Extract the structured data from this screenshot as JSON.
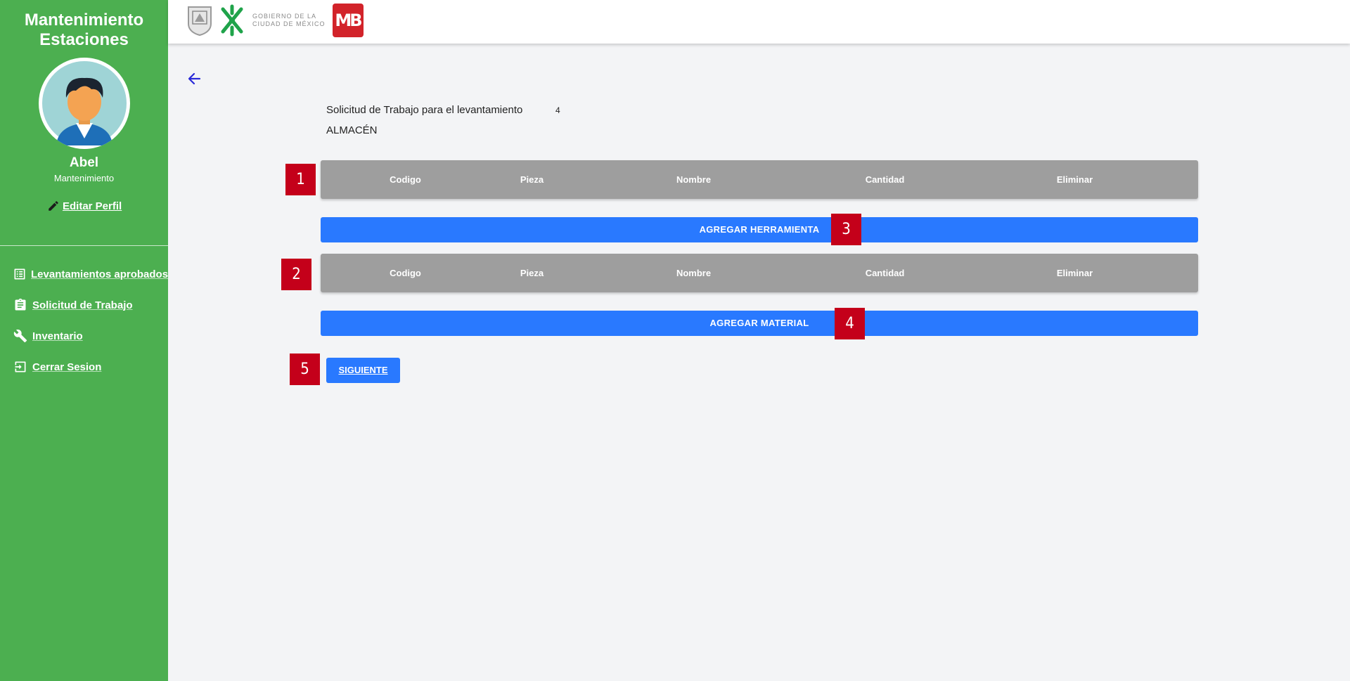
{
  "sidebar": {
    "app_title_line1": "Mantenimiento",
    "app_title_line2": "Estaciones",
    "user_name": "Abel",
    "user_role": "Mantenimiento",
    "edit_profile": "Editar Perfil",
    "items": [
      {
        "label": "Levantamientos aprobados",
        "icon": "list-icon"
      },
      {
        "label": "Solicitud de Trabajo",
        "icon": "clipboard-icon"
      },
      {
        "label": "Inventario",
        "icon": "wrench-icon"
      },
      {
        "label": "Cerrar Sesion",
        "icon": "logout-icon"
      }
    ],
    "color": "#4caf50"
  },
  "header": {
    "logo_gov_line1": "GOBIERNO DE LA",
    "logo_gov_line2": "CIUDAD DE MÉXICO",
    "logo_mb": "MB"
  },
  "main": {
    "request_title": "Solicitud de Trabajo para el levantamiento",
    "request_number": "4",
    "warehouse": "ALMACÉN",
    "tools_table": {
      "columns": [
        "Codigo",
        "Pieza",
        "Nombre",
        "Cantidad",
        "Eliminar"
      ]
    },
    "materials_table": {
      "columns": [
        "Codigo",
        "Pieza",
        "Nombre",
        "Cantidad",
        "Eliminar"
      ]
    },
    "add_tool_label": "AGREGAR HERRAMIENTA",
    "add_material_label": "AGREGAR MATERIAL",
    "next_label": "SIGUIENTE",
    "accent_color": "#2979ff"
  },
  "markers": [
    "1",
    "2",
    "3",
    "4",
    "5"
  ]
}
